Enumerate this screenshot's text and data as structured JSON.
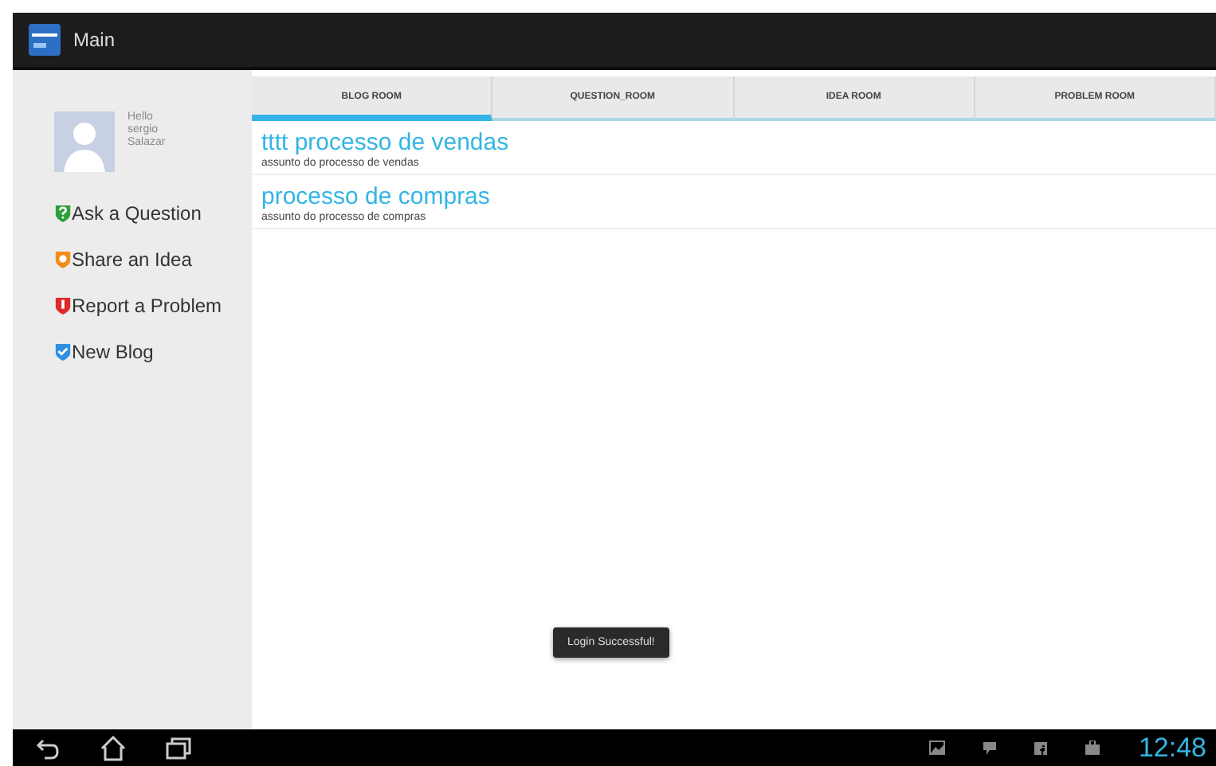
{
  "action_bar": {
    "title": "Main"
  },
  "profile": {
    "greeting": "Hello",
    "first_name": "sergio",
    "last_name": "Salazar"
  },
  "menu": [
    {
      "label": "Ask a Question",
      "kind": "question",
      "color": "#2e9e3a"
    },
    {
      "label": "Share an Idea",
      "kind": "idea",
      "color": "#f28c1c"
    },
    {
      "label": "Report a Problem",
      "kind": "problem",
      "color": "#e02a2a"
    },
    {
      "label": "New Blog",
      "kind": "blog",
      "color": "#2f8ee0"
    }
  ],
  "tabs": [
    {
      "label": "BLOG ROOM",
      "selected": true
    },
    {
      "label": "QUESTION_ROOM",
      "selected": false
    },
    {
      "label": "IDEA ROOM",
      "selected": false
    },
    {
      "label": "PROBLEM ROOM",
      "selected": false
    }
  ],
  "items": [
    {
      "title": "tttt processo de vendas",
      "subtitle": "assunto do processo de vendas"
    },
    {
      "title": "processo de compras",
      "subtitle": "assunto do processo de compras"
    }
  ],
  "toast": "Login Successful!",
  "status": {
    "time": "12:48"
  }
}
